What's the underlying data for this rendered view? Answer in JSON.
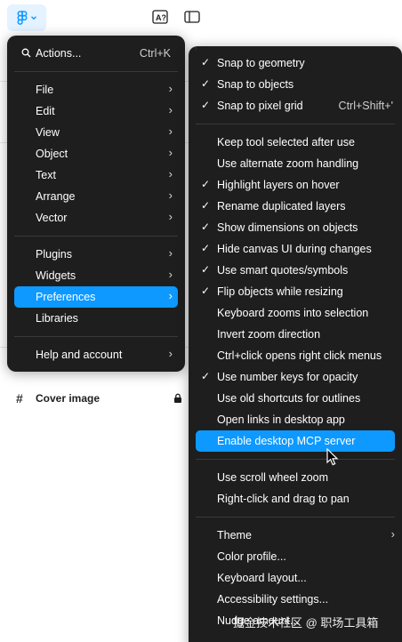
{
  "main_menu": {
    "actions": {
      "label": "Actions...",
      "shortcut": "Ctrl+K"
    },
    "items": [
      {
        "label": "File"
      },
      {
        "label": "Edit"
      },
      {
        "label": "View"
      },
      {
        "label": "Object"
      },
      {
        "label": "Text"
      },
      {
        "label": "Arrange"
      },
      {
        "label": "Vector"
      },
      {
        "label": "Plugins"
      },
      {
        "label": "Widgets"
      },
      {
        "label": "Preferences"
      },
      {
        "label": "Libraries"
      },
      {
        "label": "Help and account"
      }
    ]
  },
  "preferences_menu": {
    "items": [
      {
        "label": "Snap to geometry",
        "checked": true
      },
      {
        "label": "Snap to objects",
        "checked": true
      },
      {
        "label": "Snap to pixel grid",
        "checked": true,
        "shortcut": "Ctrl+Shift+'"
      },
      {
        "label": "Keep tool selected after use",
        "checked": false
      },
      {
        "label": "Use alternate zoom handling",
        "checked": false
      },
      {
        "label": "Highlight layers on hover",
        "checked": true
      },
      {
        "label": "Rename duplicated layers",
        "checked": true
      },
      {
        "label": "Show dimensions on objects",
        "checked": true
      },
      {
        "label": "Hide canvas UI during changes",
        "checked": true
      },
      {
        "label": "Use smart quotes/symbols",
        "checked": true
      },
      {
        "label": "Flip objects while resizing",
        "checked": true
      },
      {
        "label": "Keyboard zooms into selection",
        "checked": false
      },
      {
        "label": "Invert zoom direction",
        "checked": false
      },
      {
        "label": "Ctrl+click opens right click menus",
        "checked": false
      },
      {
        "label": "Use number keys for opacity",
        "checked": true
      },
      {
        "label": "Use old shortcuts for outlines",
        "checked": false
      },
      {
        "label": "Open links in desktop app",
        "checked": false
      },
      {
        "label": "Enable desktop MCP server",
        "checked": false
      },
      {
        "label": "Use scroll wheel zoom",
        "checked": false
      },
      {
        "label": "Right-click and drag to pan",
        "checked": false
      },
      {
        "label": "Theme",
        "checked": false
      },
      {
        "label": "Color profile...",
        "checked": false
      },
      {
        "label": "Keyboard layout...",
        "checked": false
      },
      {
        "label": "Accessibility settings...",
        "checked": false
      },
      {
        "label": "Nudge amount...",
        "checked": false
      }
    ]
  },
  "layers": {
    "cover_image": "Cover image"
  },
  "watermark": "掘金技术社区 @ 职场工具箱",
  "colors": {
    "menu_bg": "#1e1e1e",
    "accent": "#0d99ff",
    "logo_bg": "#e5f2ff"
  },
  "check_glyph": "✓",
  "chevron_glyph": "›"
}
